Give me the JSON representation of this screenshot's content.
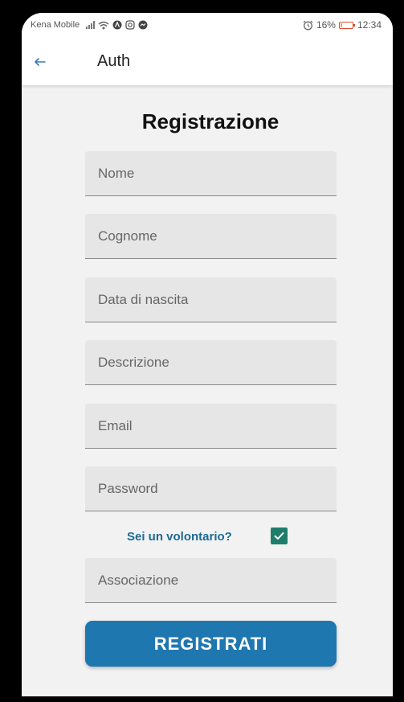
{
  "status_bar": {
    "carrier": "Kena Mobile",
    "battery": "16%",
    "battery_level": 0.16,
    "time": "12:34",
    "icons": [
      "signal-icon",
      "wifi-icon",
      "app-icon-a",
      "instagram-icon",
      "messenger-icon",
      "alarm-icon",
      "battery-icon"
    ]
  },
  "app_bar": {
    "title": "Auth",
    "back_icon": "arrow-left-icon"
  },
  "form": {
    "heading": "Registrazione",
    "fields": {
      "nome": {
        "placeholder": "Nome",
        "value": ""
      },
      "cognome": {
        "placeholder": "Cognome",
        "value": ""
      },
      "data_nascita": {
        "placeholder": "Data di nascita",
        "value": ""
      },
      "descrizione": {
        "placeholder": "Descrizione",
        "value": ""
      },
      "email": {
        "placeholder": "Email",
        "value": ""
      },
      "password": {
        "placeholder": "Password",
        "value": ""
      },
      "associazione": {
        "placeholder": "Associazione",
        "value": ""
      }
    },
    "volunteer": {
      "label": "Sei un volontario?",
      "checked": true
    },
    "submit_label": "REGISTRATI"
  },
  "colors": {
    "primary_button": "#1f77b0",
    "link_text": "#1c6a94",
    "checkbox": "#1e7d6a",
    "field_bg": "#e6e6e6",
    "page_bg": "#f2f2f2"
  }
}
